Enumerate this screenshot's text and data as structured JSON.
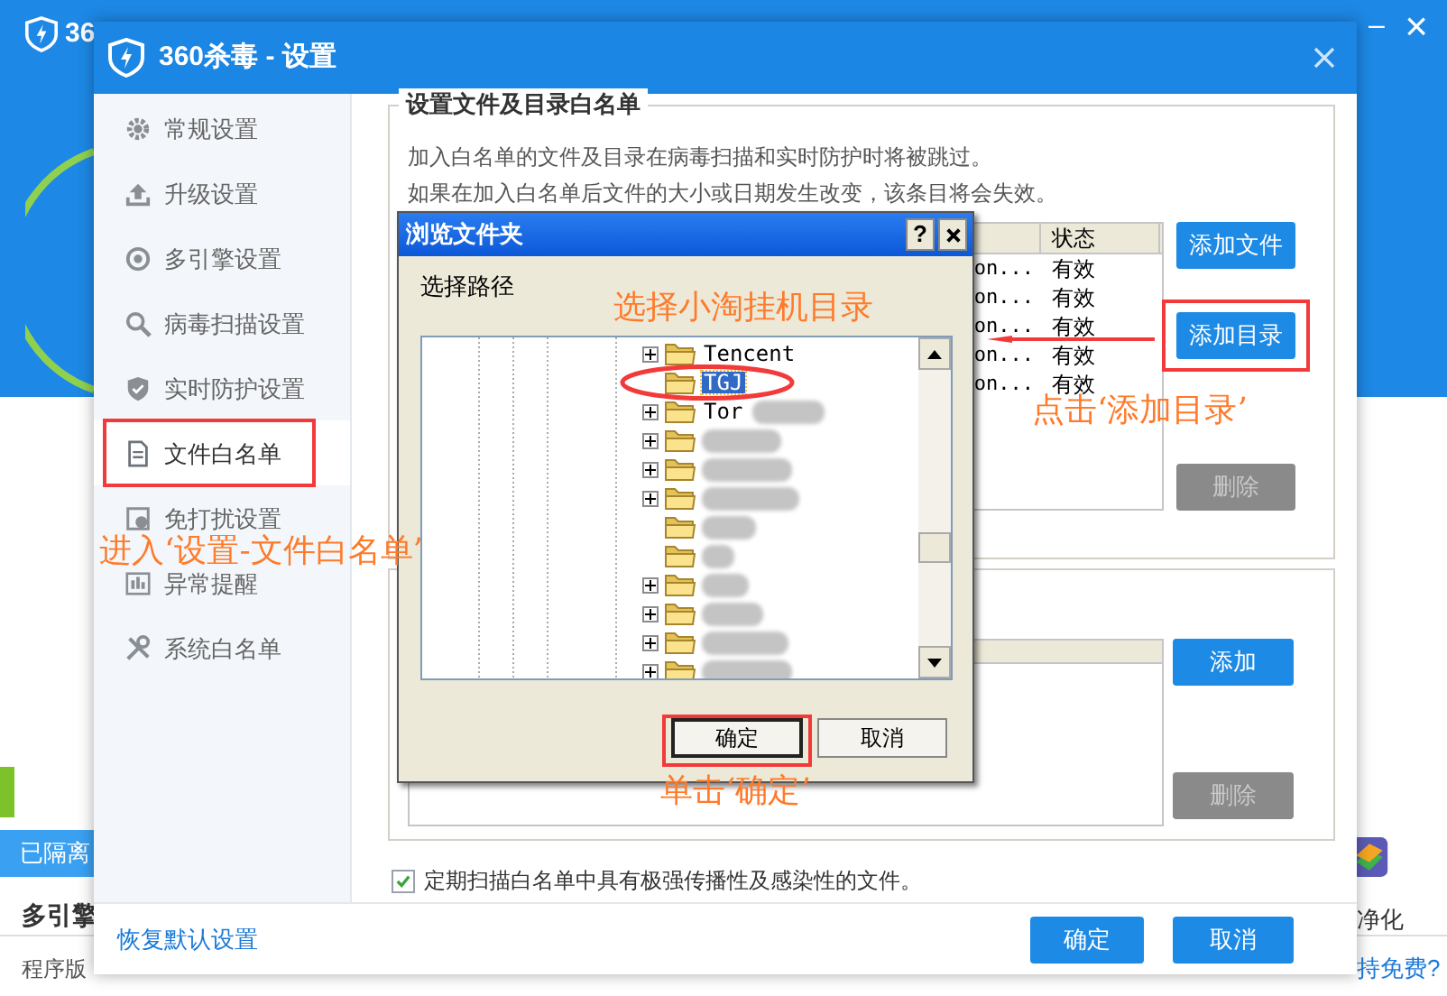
{
  "background_window": {
    "title": "36",
    "minimize": "–",
    "close": "×",
    "quarantine_tab": "已隔离",
    "section_heading": "多引擎",
    "version_label": "程序版",
    "tool_label": "净化",
    "promo_link": "持免费?"
  },
  "settings_window": {
    "title": "360杀毒 - 设置",
    "sidebar": [
      {
        "label": "常规设置",
        "selected": false
      },
      {
        "label": "升级设置",
        "selected": false
      },
      {
        "label": "多引擎设置",
        "selected": false
      },
      {
        "label": "病毒扫描设置",
        "selected": false
      },
      {
        "label": "实时防护设置",
        "selected": false
      },
      {
        "label": "文件白名单",
        "selected": true
      },
      {
        "label": "免打扰设置",
        "selected": false
      },
      {
        "label": "异常提醒",
        "selected": false
      },
      {
        "label": "系统白名单",
        "selected": false
      }
    ],
    "whitelist_group": {
      "heading": "设置文件及目录白名单",
      "description": [
        "加入白名单的文件及目录在病毒扫描和实时防护时将被跳过。",
        "如果在加入白名单后文件的大小或日期发生改变，该条目将会失效。"
      ],
      "status_column": "状态",
      "rows": [
        {
          "path": "on...",
          "status": "有效"
        },
        {
          "path": "on...",
          "status": "有效"
        },
        {
          "path": "on...",
          "status": "有效"
        },
        {
          "path": "on...",
          "status": "有效"
        },
        {
          "path": "on...",
          "status": "有效"
        }
      ],
      "buttons": [
        {
          "label": "添加文件",
          "disabled": false
        },
        {
          "label": "添加目录",
          "disabled": false
        },
        {
          "label": "删除",
          "disabled": true
        }
      ]
    },
    "second_group": {
      "buttons": [
        {
          "label": "添加",
          "disabled": false
        },
        {
          "label": "删除",
          "disabled": true
        }
      ]
    },
    "scan_option": {
      "label": "定期扫描白名单中具有极强传播性及感染性的文件。",
      "checked": true
    },
    "restore_link": "恢复默认设置",
    "buttons": [
      "确定",
      "取消"
    ]
  },
  "browse_dialog": {
    "title": "浏览文件夹",
    "help_button": "?",
    "prompt": "选择路径",
    "tree": [
      {
        "label": "Tencent",
        "expandable": true,
        "selected": false,
        "redacted": false
      },
      {
        "label": "TGJ",
        "expandable": false,
        "selected": true,
        "redacted": false
      },
      {
        "label": "Tor",
        "expandable": true,
        "selected": false,
        "redacted": true
      },
      {
        "expandable": true,
        "selected": false,
        "redacted": true
      },
      {
        "expandable": true,
        "selected": false,
        "redacted": true
      },
      {
        "expandable": true,
        "selected": false,
        "redacted": true
      },
      {
        "expandable": false,
        "selected": false,
        "redacted": true
      },
      {
        "expandable": false,
        "selected": false,
        "redacted": true
      },
      {
        "expandable": true,
        "selected": false,
        "redacted": true
      },
      {
        "expandable": true,
        "selected": false,
        "redacted": true
      },
      {
        "expandable": true,
        "selected": false,
        "redacted": true
      },
      {
        "expandable": true,
        "selected": false,
        "redacted": true
      }
    ],
    "buttons": [
      "确定",
      "取消"
    ]
  },
  "annotations": [
    {
      "text": "选择小淘挂机目录"
    },
    {
      "text": "点击‘添加目录’"
    },
    {
      "text": "进入‘设置-文件白名单’"
    },
    {
      "text": "单击‘确定’"
    }
  ]
}
